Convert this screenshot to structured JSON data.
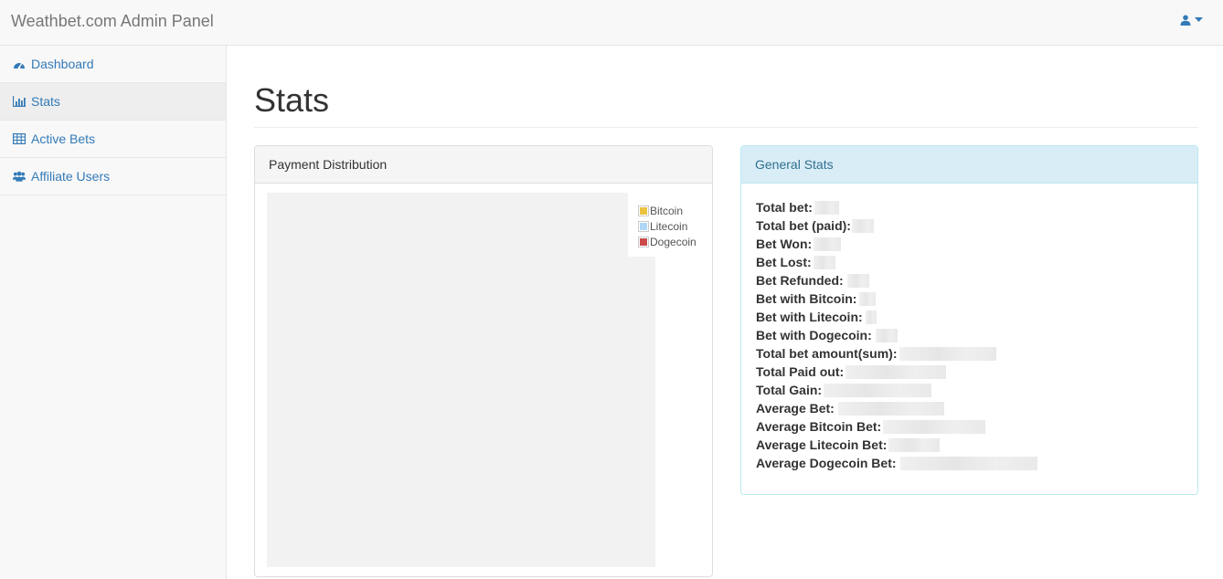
{
  "navbar": {
    "brand": "Weathbet.com Admin Panel",
    "user_icon": "user-icon",
    "caret_icon": "caret-down-icon"
  },
  "sidebar": {
    "items": [
      {
        "label": "Dashboard",
        "icon": "dashboard-icon"
      },
      {
        "label": "Stats",
        "icon": "bar-chart-icon",
        "active": true
      },
      {
        "label": "Active Bets",
        "icon": "table-icon"
      },
      {
        "label": "Affiliate Users",
        "icon": "users-icon"
      }
    ]
  },
  "main": {
    "title": "Stats",
    "payment_panel": {
      "heading": "Payment Distribution",
      "legend": [
        {
          "label": "Bitcoin",
          "color": "#edc240"
        },
        {
          "label": "Litecoin",
          "color": "#afd8f8"
        },
        {
          "label": "Dogecoin",
          "color": "#cb4b4b"
        }
      ]
    },
    "stats_panel": {
      "heading": "General Stats",
      "rows": [
        {
          "label": "Total bet:"
        },
        {
          "label": "Total bet (paid):"
        },
        {
          "label": "Bet Won:"
        },
        {
          "label": "Bet Lost:"
        },
        {
          "label": "Bet Refunded:"
        },
        {
          "label": "Bet with Bitcoin:"
        },
        {
          "label": "Bet with Litecoin:"
        },
        {
          "label": "Bet with Dogecoin:"
        },
        {
          "label": "Total bet amount(sum):"
        },
        {
          "label": "Total Paid out:"
        },
        {
          "label": "Total Gain:"
        },
        {
          "label": "Average Bet:"
        },
        {
          "label": "Average Bitcoin Bet:"
        },
        {
          "label": "Average Litecoin Bet:"
        },
        {
          "label": "Average Dogecoin Bet:"
        }
      ]
    }
  },
  "colors": {
    "link": "#337ab7",
    "info_heading_bg": "#d9edf7",
    "info_heading_text": "#31708f"
  }
}
